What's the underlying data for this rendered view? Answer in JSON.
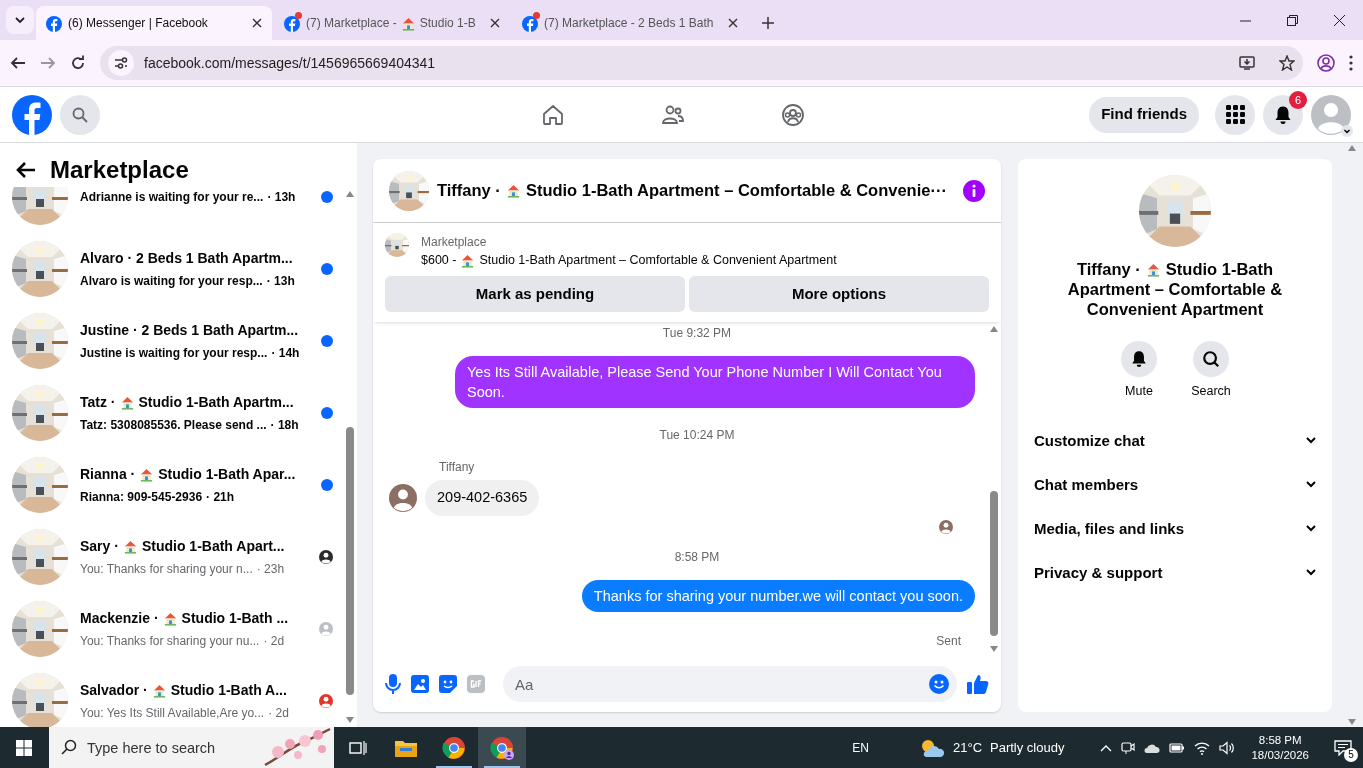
{
  "browser": {
    "tabs": [
      {
        "parts": [
          "(6) Messenger | Facebook"
        ],
        "selected": true,
        "notify": false
      },
      {
        "parts": [
          "(7) Marketplace -",
          "Studio 1-B"
        ],
        "selected": false,
        "notify": true
      },
      {
        "parts": [
          "(7) Marketplace - 2 Beds 1 Bath"
        ],
        "selected": false,
        "notify": true
      }
    ],
    "url": "facebook.com/messages/t/1456965669404341"
  },
  "header": {
    "nav": [
      {
        "kind": "home",
        "selected": false
      },
      {
        "kind": "friends",
        "selected": false
      },
      {
        "kind": "groups",
        "selected": false
      }
    ],
    "find_friends": "Find friends",
    "notification_count": "6"
  },
  "sidebar": {
    "title": "Marketplace",
    "conversations": [
      {
        "preview": "Adrianne is waiting for your re...",
        "time": "· 13h",
        "unread": true
      },
      {
        "parts": [
          "Alvaro · 2 Beds 1 Bath Apartm..."
        ],
        "preview": "Alvaro is waiting for your resp...",
        "time": "· 13h",
        "unread": true
      },
      {
        "parts": [
          "Justine · 2 Beds 1 Bath Apartm..."
        ],
        "preview": "Justine is waiting for your resp...",
        "time": "· 14h",
        "unread": true
      },
      {
        "parts": [
          "Tatz ·",
          "Studio 1-Bath Apartm..."
        ],
        "preview": "Tatz: 5308085536. Please send ...",
        "time": "· 18h",
        "unread": true
      },
      {
        "parts": [
          "Rianna ·",
          "Studio 1-Bath Apar..."
        ],
        "preview": "Rianna: 909-545-2936",
        "time": "· 21h",
        "unread": true
      },
      {
        "parts": [
          "Sary ·",
          "Studio 1-Bath Apart..."
        ],
        "preview": "You: Thanks for sharing your n...",
        "time": "· 23h",
        "unread": false,
        "color": "#2b2b2b"
      },
      {
        "parts": [
          "Mackenzie ·",
          "Studio 1-Bath ..."
        ],
        "preview": "You: Thanks for sharing your nu...",
        "time": "· 2d",
        "unread": false,
        "color": "#bcc0c4"
      },
      {
        "parts": [
          "Salvador ·",
          "Studio 1-Bath A..."
        ],
        "preview": "You: Yes Its Still Available,Are yo...",
        "time": "· 2d",
        "unread": false,
        "color": "#e4352a"
      }
    ]
  },
  "chat": {
    "title_parts": [
      "Tiffany ·",
      "Studio 1-Bath Apartment – Comfortable & Convenie···"
    ],
    "listing": {
      "label": "Marketplace",
      "parts": [
        "$600 -",
        "Studio 1-Bath Apartment – Comfortable & Convenient Apartment"
      ]
    },
    "actions": [
      "Mark as pending",
      "More options"
    ],
    "messages": [
      {
        "kind": "time",
        "text": "Tue 9:32 PM"
      },
      {
        "kind": "outgoing",
        "text": "Yes Its Still Available, Please Send Your Phone Number I Will Contact You Soon.",
        "color": "#a033ff"
      },
      {
        "kind": "time",
        "text": "Tue 10:24 PM"
      },
      {
        "kind": "sender",
        "text": "Tiffany"
      },
      {
        "kind": "incoming",
        "text": "209-402-6365"
      },
      {
        "kind": "seen"
      },
      {
        "kind": "time",
        "text": "8:58 PM"
      },
      {
        "kind": "outgoing",
        "text": "Thanks for sharing your number.we will contact you soon.",
        "color": "#0a7cff"
      },
      {
        "kind": "status",
        "text": "Sent"
      }
    ],
    "composer": {
      "placeholder": "Aa"
    }
  },
  "details": {
    "title_lines": [
      [
        "Tiffany ·",
        "Studio 1-Bath"
      ],
      [
        "Apartment – Comfortable &"
      ],
      [
        "Convenient Apartment"
      ]
    ],
    "actions": [
      {
        "kind": "mute",
        "label": "Mute"
      },
      {
        "kind": "search",
        "label": "Search"
      }
    ],
    "sections": [
      {
        "label": "Customize chat",
        "expanded": false
      },
      {
        "label": "Chat members",
        "expanded": false
      },
      {
        "label": "Media, files and links",
        "expanded": false
      },
      {
        "label": "Privacy & support",
        "expanded": false
      }
    ]
  },
  "taskbar": {
    "search_placeholder": "Type here to search",
    "language": "EN",
    "temperature": "21°C",
    "weather": "Partly cloudy",
    "time": "8:58 PM",
    "date": "18/03/2026",
    "notifications": "5"
  }
}
